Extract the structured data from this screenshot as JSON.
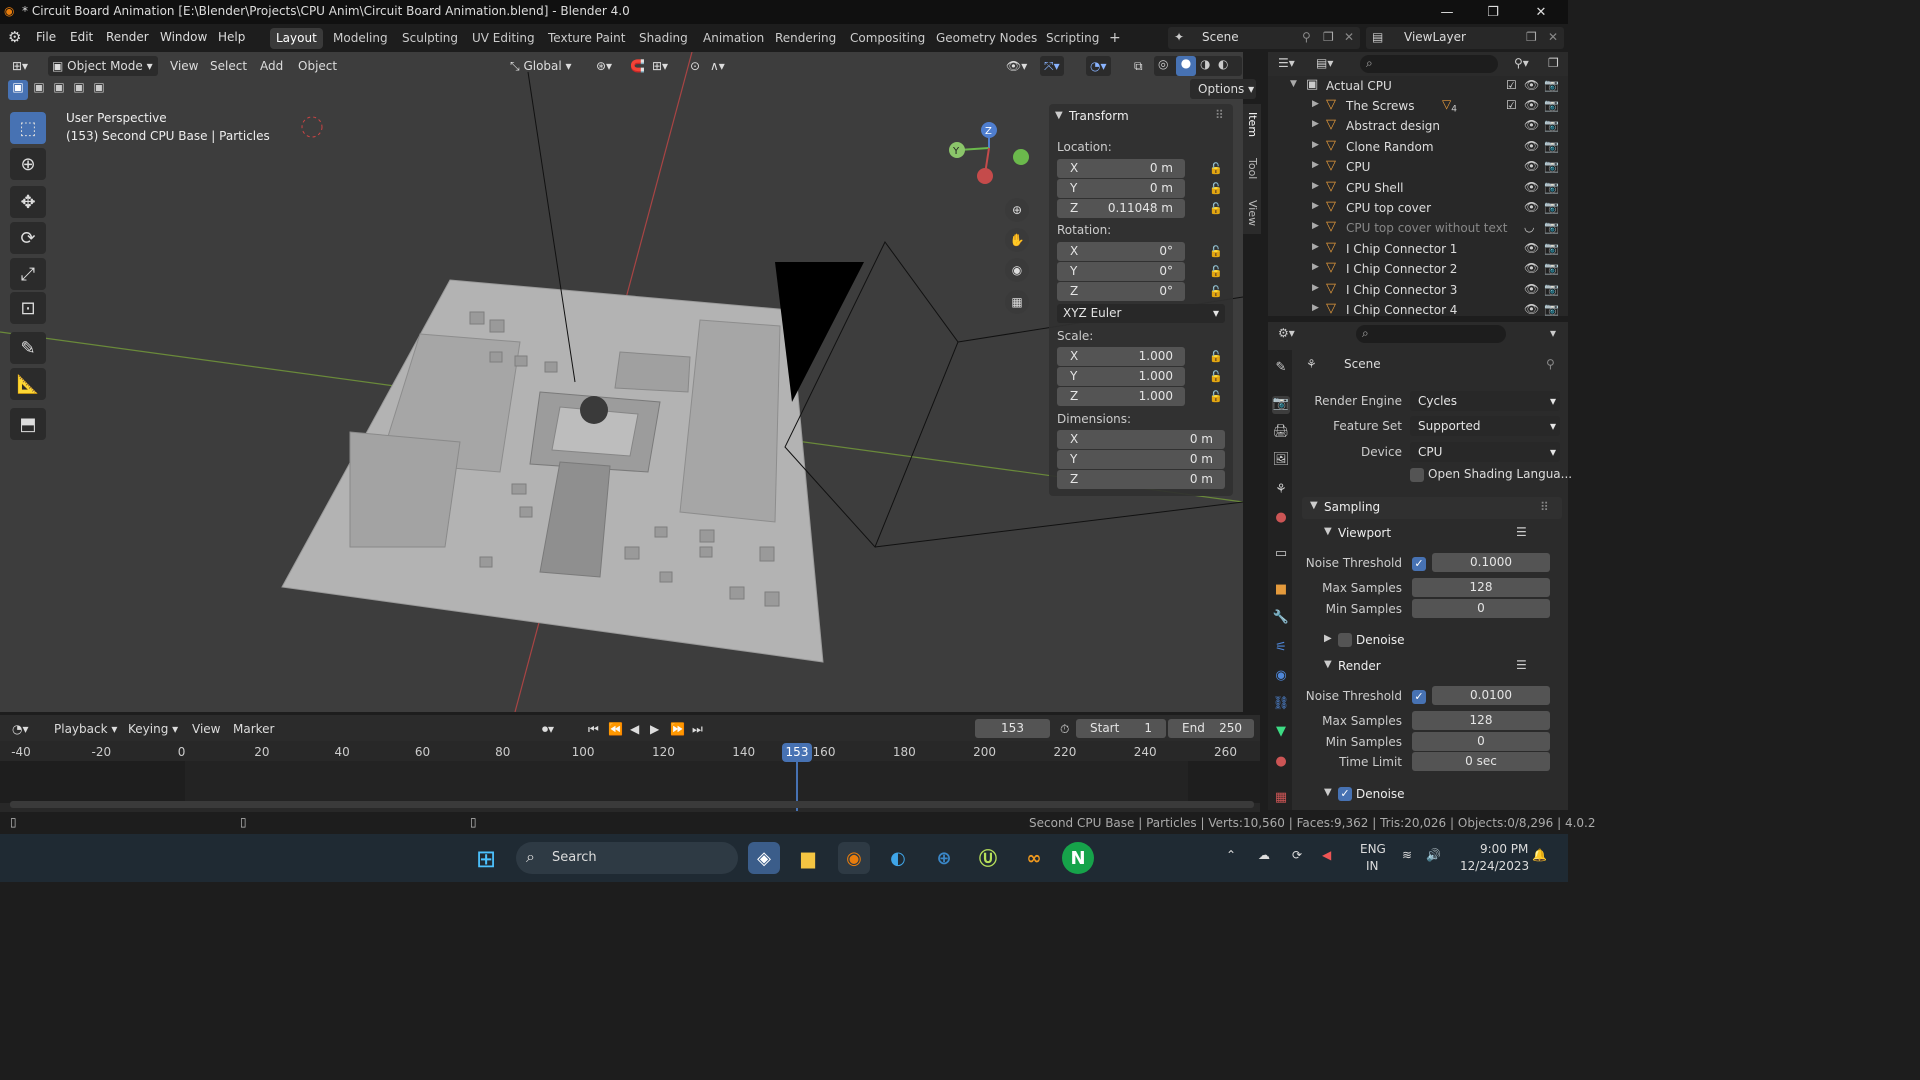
{
  "titlebar": {
    "title": "* Circuit Board Animation [E:\\Blender\\Projects\\CPU Anim\\Circuit Board Animation.blend] - Blender 4.0",
    "minimize": "—",
    "maximize": "❐",
    "close": "✕"
  },
  "menubar": {
    "items": [
      "File",
      "Edit",
      "Render",
      "Window",
      "Help"
    ],
    "workspaces": [
      "Layout",
      "Modeling",
      "Sculpting",
      "UV Editing",
      "Texture Paint",
      "Shading",
      "Animation",
      "Rendering",
      "Compositing",
      "Geometry Nodes",
      "Scripting"
    ],
    "active_workspace": "Layout",
    "add_workspace": "+",
    "scene": "Scene",
    "view_layer": "ViewLayer"
  },
  "viewport_header": {
    "mode": "Object Mode",
    "menus": [
      "View",
      "Select",
      "Add",
      "Object"
    ],
    "orientation": "Global",
    "options_label": "Options"
  },
  "viewport": {
    "perspective": "User Perspective",
    "object_info": "(153) Second CPU Base | Particles",
    "gizmo": {
      "x": "X",
      "y": "Y",
      "z": "Z"
    }
  },
  "npanel": {
    "header": "Transform",
    "location_label": "Location:",
    "location": [
      {
        "axis": "X",
        "value": "0 m"
      },
      {
        "axis": "Y",
        "value": "0 m"
      },
      {
        "axis": "Z",
        "value": "0.11048 m"
      }
    ],
    "rotation_label": "Rotation:",
    "rotation": [
      {
        "axis": "X",
        "value": "0°"
      },
      {
        "axis": "Y",
        "value": "0°"
      },
      {
        "axis": "Z",
        "value": "0°"
      }
    ],
    "rotation_mode": "XYZ Euler",
    "scale_label": "Scale:",
    "scale": [
      {
        "axis": "X",
        "value": "1.000"
      },
      {
        "axis": "Y",
        "value": "1.000"
      },
      {
        "axis": "Z",
        "value": "1.000"
      }
    ],
    "dimensions_label": "Dimensions:",
    "dimensions": [
      {
        "axis": "X",
        "value": "0 m"
      },
      {
        "axis": "Y",
        "value": "0 m"
      },
      {
        "axis": "Z",
        "value": "0 m"
      }
    ],
    "tabs": [
      "Item",
      "Tool",
      "View"
    ]
  },
  "outliner": {
    "collection": "Actual CPU",
    "items": [
      {
        "name": "The Screws",
        "badge": "4"
      },
      {
        "name": "Abstract design"
      },
      {
        "name": "Clone Random"
      },
      {
        "name": "CPU"
      },
      {
        "name": "CPU Shell"
      },
      {
        "name": "CPU top cover"
      },
      {
        "name": "CPU top cover without text"
      },
      {
        "name": "I Chip Connector 1"
      },
      {
        "name": "I Chip Connector 2"
      },
      {
        "name": "I Chip Connector 3"
      },
      {
        "name": "I Chip Connector 4"
      }
    ]
  },
  "properties": {
    "context": "Scene",
    "render_engine_label": "Render Engine",
    "render_engine": "Cycles",
    "feature_set_label": "Feature Set",
    "feature_set": "Supported",
    "device_label": "Device",
    "device": "CPU",
    "osl_label": "Open Shading Langua...",
    "sampling_label": "Sampling",
    "viewport_label": "Viewport",
    "noise_threshold_label": "Noise Threshold",
    "viewport_noise": "0.1000",
    "max_samples_label": "Max Samples",
    "viewport_max": "128",
    "min_samples_label": "Min Samples",
    "viewport_min": "0",
    "denoise_label": "Denoise",
    "render_label": "Render",
    "render_noise": "0.0100",
    "render_max": "128",
    "render_min": "0",
    "time_limit_label": "Time Limit",
    "time_limit": "0 sec"
  },
  "timeline": {
    "menus": [
      "Playback",
      "Keying",
      "View",
      "Marker"
    ],
    "current_frame": "153",
    "start_label": "Start",
    "start": "1",
    "end_label": "End",
    "end": "250",
    "ticks": [
      "-40",
      "-20",
      "0",
      "20",
      "40",
      "60",
      "80",
      "100",
      "120",
      "140",
      "160",
      "180",
      "200",
      "220",
      "240",
      "260"
    ]
  },
  "statusbar": {
    "info": "Second CPU Base | Particles",
    "verts": "Verts:10,560",
    "faces": "Faces:9,362",
    "tris": "Tris:20,026",
    "objects": "Objects:0/8,296",
    "version": "4.0.2"
  },
  "taskbar": {
    "search_placeholder": "Search",
    "language": "ENG",
    "region": "IN",
    "time": "9:00 PM",
    "date": "12/24/2023"
  },
  "colors": {
    "accent": "#4772b3",
    "object_icon": "#e49a3c",
    "mesh_icon": "#3ddc84",
    "frame_current": "#4772b3"
  }
}
